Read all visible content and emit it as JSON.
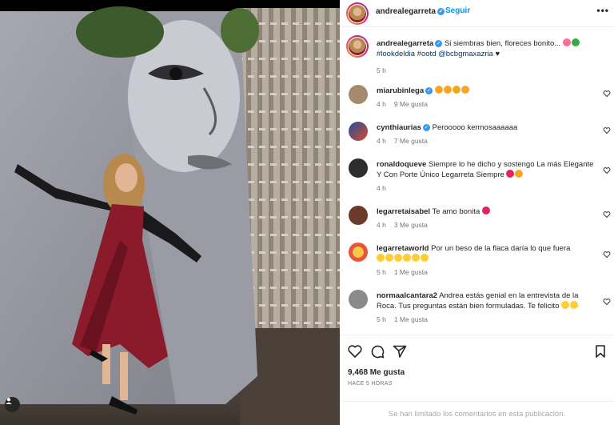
{
  "post": {
    "username": "andrealegarreta",
    "follow_label": "Seguir",
    "more_label": "•••",
    "caption": {
      "username": "andrealegarreta",
      "text": "Si siembras bien, floreces bonito...",
      "hashtags": "#lookdeldia #ootd @bcbgmaxazria",
      "time": "5 h"
    }
  },
  "comments": [
    {
      "username": "miarubinlega",
      "text": "",
      "time": "4 h",
      "likes": "9 Me gusta",
      "emoji_color": "orange",
      "emoji_count": 4
    },
    {
      "username": "cynthiaurias",
      "text": "Perooooo kermosaaaaaa",
      "time": "4 h",
      "likes": "7 Me gusta"
    },
    {
      "username": "ronaldoqueve",
      "text": "Siempre lo he dicho y sostengo La más Elegante Y Con Porte Único Legarreta Siempre",
      "time": "4 h",
      "likes": ""
    },
    {
      "username": "legarretaisabel",
      "text": "Te amo bonita",
      "time": "4 h",
      "likes": "3 Me gusta"
    },
    {
      "username": "legarretaworld",
      "text": "Por un beso de la flaca daría lo que fuera",
      "time": "5 h",
      "likes": "1 Me gusta"
    },
    {
      "username": "normaalcantara2",
      "text": "Andrea estás genial en la entrevista de la Roca. Tus preguntas están bien formuladas. Te felicito",
      "time": "5 h",
      "likes": "1 Me gusta"
    }
  ],
  "footer": {
    "likes": "9,468 Me gusta",
    "ago": "HACE 5 HORAS",
    "limited": "Se han limitado los comentarios en esta publicación."
  },
  "icons": {
    "heart": "heart-icon",
    "comment": "comment-icon",
    "share": "share-icon",
    "save": "bookmark-icon",
    "tag": "person-tag-icon",
    "verified": "verified-badge-icon"
  },
  "colors": {
    "accent": "#0095f6",
    "verified": "#3897f0",
    "dress": "#8b1a2b",
    "wall": "#8e8e96"
  }
}
